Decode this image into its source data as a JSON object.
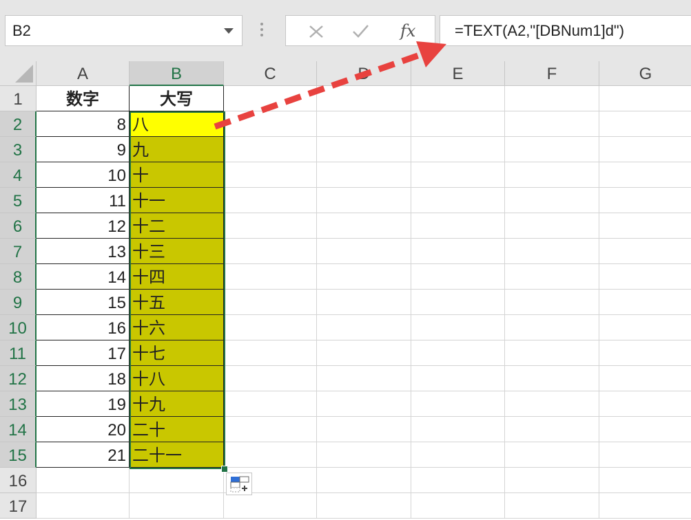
{
  "formula_bar": {
    "name_box": "B2",
    "cancel_icon": "close-icon",
    "enter_icon": "check-icon",
    "fx_icon": "fx-icon",
    "formula": "=TEXT(A2,\"[DBNum1]d\")"
  },
  "columns": [
    "A",
    "B",
    "C",
    "D",
    "E",
    "F",
    "G"
  ],
  "rows": [
    "1",
    "2",
    "3",
    "4",
    "5",
    "6",
    "7",
    "8",
    "9",
    "10",
    "11",
    "12",
    "13",
    "14",
    "15",
    "16",
    "17"
  ],
  "headers": {
    "a1": "数字",
    "b1": "大写"
  },
  "data": [
    {
      "a": "8",
      "b": "八"
    },
    {
      "a": "9",
      "b": "九"
    },
    {
      "a": "10",
      "b": "十"
    },
    {
      "a": "11",
      "b": "十一"
    },
    {
      "a": "12",
      "b": "十二"
    },
    {
      "a": "13",
      "b": "十三"
    },
    {
      "a": "14",
      "b": "十四"
    },
    {
      "a": "15",
      "b": "十五"
    },
    {
      "a": "16",
      "b": "十六"
    },
    {
      "a": "17",
      "b": "十七"
    },
    {
      "a": "18",
      "b": "十八"
    },
    {
      "a": "19",
      "b": "十九"
    },
    {
      "a": "20",
      "b": "二十"
    },
    {
      "a": "21",
      "b": "二十一"
    }
  ],
  "colors": {
    "highlight_active": "#ffff00",
    "highlight_range": "#c9c700",
    "selection": "#217346",
    "arrow": "#e8423f"
  }
}
